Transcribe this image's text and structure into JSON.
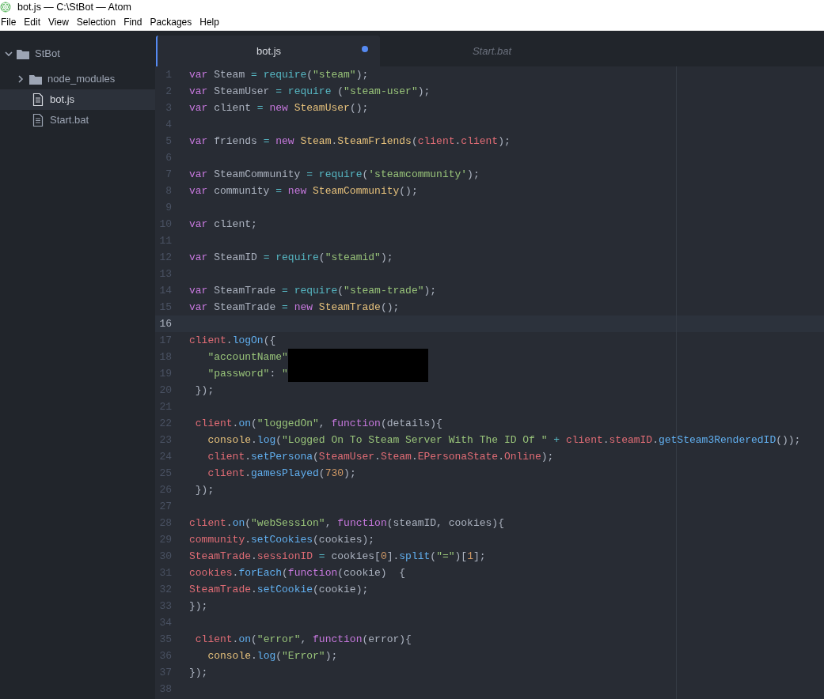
{
  "window": {
    "title": "bot.js — C:\\StBot — Atom"
  },
  "menu": [
    "File",
    "Edit",
    "View",
    "Selection",
    "Find",
    "Packages",
    "Help"
  ],
  "tree": [
    {
      "label": "StBot",
      "kind": "folder",
      "expanded": true,
      "selected": false,
      "children": [
        {
          "label": "node_modules",
          "kind": "folder",
          "expanded": false,
          "selected": false
        },
        {
          "label": "bot.js",
          "kind": "file",
          "selected": true
        },
        {
          "label": "Start.bat",
          "kind": "file",
          "selected": false
        }
      ]
    }
  ],
  "tabs": [
    {
      "label": "bot.js",
      "selected": true,
      "modified": true,
      "pending": false
    },
    {
      "label": "Start.bat",
      "selected": false,
      "modified": false,
      "pending": true
    }
  ],
  "editor": {
    "lines": [
      {
        "number": "1",
        "current": false,
        "tokens": [
          {
            "kind": "keyword",
            "text": "var"
          },
          {
            "kind": "plain",
            "text": " Steam "
          },
          {
            "kind": "operator",
            "text": "="
          },
          {
            "kind": "support",
            "text": " require"
          },
          {
            "kind": "plain",
            "text": "("
          },
          {
            "kind": "string",
            "text": "\"steam\""
          },
          {
            "kind": "plain",
            "text": ");"
          }
        ]
      },
      {
        "number": "2",
        "current": false,
        "tokens": [
          {
            "kind": "keyword",
            "text": "var"
          },
          {
            "kind": "plain",
            "text": " SteamUser "
          },
          {
            "kind": "operator",
            "text": "="
          },
          {
            "kind": "support",
            "text": " require"
          },
          {
            "kind": "plain",
            "text": " ("
          },
          {
            "kind": "string",
            "text": "\"steam-user\""
          },
          {
            "kind": "plain",
            "text": ");"
          }
        ]
      },
      {
        "number": "3",
        "current": false,
        "tokens": [
          {
            "kind": "keyword",
            "text": "var"
          },
          {
            "kind": "plain",
            "text": " client "
          },
          {
            "kind": "operator",
            "text": "="
          },
          {
            "kind": "keyword",
            "text": " new"
          },
          {
            "kind": "class",
            "text": " SteamUser"
          },
          {
            "kind": "plain",
            "text": "();"
          }
        ]
      },
      {
        "number": "4",
        "current": false
      },
      {
        "number": "5",
        "current": false,
        "tokens": [
          {
            "kind": "keyword",
            "text": "var"
          },
          {
            "kind": "plain",
            "text": " friends "
          },
          {
            "kind": "operator",
            "text": "="
          },
          {
            "kind": "keyword",
            "text": " new"
          },
          {
            "kind": "class",
            "text": " Steam"
          },
          {
            "kind": "plain",
            "text": "."
          },
          {
            "kind": "class",
            "text": "SteamFriends"
          },
          {
            "kind": "plain",
            "text": "("
          },
          {
            "kind": "variable",
            "text": "client"
          },
          {
            "kind": "plain",
            "text": "."
          },
          {
            "kind": "variable",
            "text": "client"
          },
          {
            "kind": "plain",
            "text": ");"
          }
        ]
      },
      {
        "number": "6",
        "current": false
      },
      {
        "number": "7",
        "current": false,
        "tokens": [
          {
            "kind": "keyword",
            "text": "var"
          },
          {
            "kind": "plain",
            "text": " SteamCommunity "
          },
          {
            "kind": "operator",
            "text": "="
          },
          {
            "kind": "support",
            "text": " require"
          },
          {
            "kind": "plain",
            "text": "("
          },
          {
            "kind": "string",
            "text": "'steamcommunity'"
          },
          {
            "kind": "plain",
            "text": ");"
          }
        ]
      },
      {
        "number": "8",
        "current": false,
        "tokens": [
          {
            "kind": "keyword",
            "text": "var"
          },
          {
            "kind": "plain",
            "text": " community "
          },
          {
            "kind": "operator",
            "text": "="
          },
          {
            "kind": "keyword",
            "text": " new"
          },
          {
            "kind": "class",
            "text": " SteamCommunity"
          },
          {
            "kind": "plain",
            "text": "();"
          }
        ]
      },
      {
        "number": "9",
        "current": false
      },
      {
        "number": "10",
        "current": false,
        "tokens": [
          {
            "kind": "keyword",
            "text": "var"
          },
          {
            "kind": "plain",
            "text": " client;"
          }
        ]
      },
      {
        "number": "11",
        "current": false
      },
      {
        "number": "12",
        "current": false,
        "tokens": [
          {
            "kind": "keyword",
            "text": "var"
          },
          {
            "kind": "plain",
            "text": " SteamID "
          },
          {
            "kind": "operator",
            "text": "="
          },
          {
            "kind": "support",
            "text": " require"
          },
          {
            "kind": "plain",
            "text": "("
          },
          {
            "kind": "string",
            "text": "\"steamid\""
          },
          {
            "kind": "plain",
            "text": ");"
          }
        ]
      },
      {
        "number": "13",
        "current": false
      },
      {
        "number": "14",
        "current": false,
        "tokens": [
          {
            "kind": "keyword",
            "text": "var"
          },
          {
            "kind": "plain",
            "text": " SteamTrade "
          },
          {
            "kind": "operator",
            "text": "="
          },
          {
            "kind": "support",
            "text": " require"
          },
          {
            "kind": "plain",
            "text": "("
          },
          {
            "kind": "string",
            "text": "\"steam-trade\""
          },
          {
            "kind": "plain",
            "text": ");"
          }
        ]
      },
      {
        "number": "15",
        "current": false,
        "tokens": [
          {
            "kind": "keyword",
            "text": "var"
          },
          {
            "kind": "plain",
            "text": " SteamTrade "
          },
          {
            "kind": "operator",
            "text": "="
          },
          {
            "kind": "keyword",
            "text": " new"
          },
          {
            "kind": "class",
            "text": " SteamTrade"
          },
          {
            "kind": "plain",
            "text": "();"
          }
        ]
      },
      {
        "number": "16",
        "current": true
      },
      {
        "number": "17",
        "current": false,
        "tokens": [
          {
            "kind": "variable",
            "text": "client"
          },
          {
            "kind": "plain",
            "text": "."
          },
          {
            "kind": "method",
            "text": "logOn"
          },
          {
            "kind": "plain",
            "text": "({"
          }
        ]
      },
      {
        "number": "18",
        "current": false,
        "redacted": true,
        "tokens": [
          {
            "kind": "string",
            "text": "   \"accountName\""
          }
        ]
      },
      {
        "number": "19",
        "current": false,
        "redacted": true,
        "tokens": [
          {
            "kind": "string",
            "text": "   \"password\""
          },
          {
            "kind": "plain",
            "text": ": "
          },
          {
            "kind": "string",
            "text": "\""
          }
        ]
      },
      {
        "number": "20",
        "current": false,
        "tokens": [
          {
            "kind": "plain",
            "text": " });"
          }
        ]
      },
      {
        "number": "21",
        "current": false
      },
      {
        "number": "22",
        "current": false,
        "tokens": [
          {
            "kind": "variable",
            "text": " client"
          },
          {
            "kind": "plain",
            "text": "."
          },
          {
            "kind": "method",
            "text": "on"
          },
          {
            "kind": "plain",
            "text": "("
          },
          {
            "kind": "string",
            "text": "\"loggedOn\""
          },
          {
            "kind": "plain",
            "text": ", "
          },
          {
            "kind": "keyword",
            "text": "function"
          },
          {
            "kind": "plain",
            "text": "(details){"
          }
        ]
      },
      {
        "number": "23",
        "current": false,
        "tokens": [
          {
            "kind": "class",
            "text": "   console"
          },
          {
            "kind": "plain",
            "text": "."
          },
          {
            "kind": "method",
            "text": "log"
          },
          {
            "kind": "plain",
            "text": "("
          },
          {
            "kind": "string",
            "text": "\"Logged On To Steam Server With The ID Of \""
          },
          {
            "kind": "operator",
            "text": " + "
          },
          {
            "kind": "variable",
            "text": "client"
          },
          {
            "kind": "plain",
            "text": "."
          },
          {
            "kind": "variable",
            "text": "steamID"
          },
          {
            "kind": "plain",
            "text": "."
          },
          {
            "kind": "method",
            "text": "getSteam3RenderedID"
          },
          {
            "kind": "plain",
            "text": "());"
          }
        ]
      },
      {
        "number": "24",
        "current": false,
        "tokens": [
          {
            "kind": "variable",
            "text": "   client"
          },
          {
            "kind": "plain",
            "text": "."
          },
          {
            "kind": "method",
            "text": "setPersona"
          },
          {
            "kind": "plain",
            "text": "("
          },
          {
            "kind": "variable",
            "text": "SteamUser"
          },
          {
            "kind": "plain",
            "text": "."
          },
          {
            "kind": "variable",
            "text": "Steam"
          },
          {
            "kind": "plain",
            "text": "."
          },
          {
            "kind": "variable",
            "text": "EPersonaState"
          },
          {
            "kind": "plain",
            "text": "."
          },
          {
            "kind": "variable",
            "text": "Online"
          },
          {
            "kind": "plain",
            "text": ");"
          }
        ]
      },
      {
        "number": "25",
        "current": false,
        "tokens": [
          {
            "kind": "variable",
            "text": "   client"
          },
          {
            "kind": "plain",
            "text": "."
          },
          {
            "kind": "method",
            "text": "gamesPlayed"
          },
          {
            "kind": "plain",
            "text": "("
          },
          {
            "kind": "number",
            "text": "730"
          },
          {
            "kind": "plain",
            "text": ");"
          }
        ]
      },
      {
        "number": "26",
        "current": false,
        "tokens": [
          {
            "kind": "plain",
            "text": " });"
          }
        ]
      },
      {
        "number": "27",
        "current": false
      },
      {
        "number": "28",
        "current": false,
        "tokens": [
          {
            "kind": "variable",
            "text": "client"
          },
          {
            "kind": "plain",
            "text": "."
          },
          {
            "kind": "method",
            "text": "on"
          },
          {
            "kind": "plain",
            "text": "("
          },
          {
            "kind": "string",
            "text": "\"webSession\""
          },
          {
            "kind": "plain",
            "text": ", "
          },
          {
            "kind": "keyword",
            "text": "function"
          },
          {
            "kind": "plain",
            "text": "(steamID, cookies){"
          }
        ]
      },
      {
        "number": "29",
        "current": false,
        "tokens": [
          {
            "kind": "variable",
            "text": "community"
          },
          {
            "kind": "plain",
            "text": "."
          },
          {
            "kind": "method",
            "text": "setCookies"
          },
          {
            "kind": "plain",
            "text": "(cookies);"
          }
        ]
      },
      {
        "number": "30",
        "current": false,
        "tokens": [
          {
            "kind": "variable",
            "text": "SteamTrade"
          },
          {
            "kind": "plain",
            "text": "."
          },
          {
            "kind": "variable",
            "text": "sessionID"
          },
          {
            "kind": "operator",
            "text": " = "
          },
          {
            "kind": "plain",
            "text": "cookies["
          },
          {
            "kind": "number",
            "text": "0"
          },
          {
            "kind": "plain",
            "text": "]."
          },
          {
            "kind": "method",
            "text": "split"
          },
          {
            "kind": "plain",
            "text": "("
          },
          {
            "kind": "string",
            "text": "\"=\""
          },
          {
            "kind": "plain",
            "text": ")["
          },
          {
            "kind": "number",
            "text": "1"
          },
          {
            "kind": "plain",
            "text": "];"
          }
        ]
      },
      {
        "number": "31",
        "current": false,
        "tokens": [
          {
            "kind": "variable",
            "text": "cookies"
          },
          {
            "kind": "plain",
            "text": "."
          },
          {
            "kind": "method",
            "text": "forEach"
          },
          {
            "kind": "plain",
            "text": "("
          },
          {
            "kind": "keyword",
            "text": "function"
          },
          {
            "kind": "plain",
            "text": "(cookie)  {"
          }
        ]
      },
      {
        "number": "32",
        "current": false,
        "tokens": [
          {
            "kind": "variable",
            "text": "SteamTrade"
          },
          {
            "kind": "plain",
            "text": "."
          },
          {
            "kind": "method",
            "text": "setCookie"
          },
          {
            "kind": "plain",
            "text": "(cookie);"
          }
        ]
      },
      {
        "number": "33",
        "current": false,
        "tokens": [
          {
            "kind": "plain",
            "text": "});"
          }
        ]
      },
      {
        "number": "34",
        "current": false
      },
      {
        "number": "35",
        "current": false,
        "tokens": [
          {
            "kind": "variable",
            "text": " client"
          },
          {
            "kind": "plain",
            "text": "."
          },
          {
            "kind": "method",
            "text": "on"
          },
          {
            "kind": "plain",
            "text": "("
          },
          {
            "kind": "string",
            "text": "\"error\""
          },
          {
            "kind": "plain",
            "text": ", "
          },
          {
            "kind": "keyword",
            "text": "function"
          },
          {
            "kind": "plain",
            "text": "(error){"
          }
        ]
      },
      {
        "number": "36",
        "current": false,
        "tokens": [
          {
            "kind": "class",
            "text": "   console"
          },
          {
            "kind": "plain",
            "text": "."
          },
          {
            "kind": "method",
            "text": "log"
          },
          {
            "kind": "plain",
            "text": "("
          },
          {
            "kind": "string",
            "text": "\"Error\""
          },
          {
            "kind": "plain",
            "text": ");"
          }
        ]
      },
      {
        "number": "37",
        "current": false,
        "tokens": [
          {
            "kind": "plain",
            "text": "});"
          }
        ]
      },
      {
        "number": "38",
        "current": false
      }
    ]
  }
}
